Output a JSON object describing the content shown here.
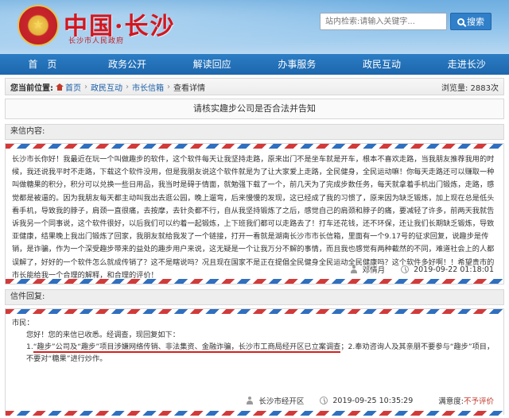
{
  "header": {
    "site_title": "中国·长沙",
    "site_subtitle": "长沙市人民政府",
    "emblem_star": "★",
    "search_placeholder": "站内检索:请输入关键字...",
    "search_button": "搜索"
  },
  "nav": [
    "首　页",
    "政务公开",
    "解读回应",
    "办事服务",
    "政民互动",
    "走进长沙"
  ],
  "breadcrumb": {
    "lead": "您当前位置:",
    "items": [
      "首页",
      "政民互动",
      "市长信箱",
      "查看详情"
    ],
    "views_label": "浏览量:",
    "views_value": "2883次"
  },
  "doc_title": "请核实趣步公司是否合法并告知",
  "letter": {
    "section_label": "来信内容:",
    "body": "长沙市长你好！我最近在玩一个叫做趣步的软件，这个软件每天让我坚持走路，原来出门不是坐车就是开车，根本不喜欢走路，当我朋友推荐我用的时候，我还说我平时不走路，下载这个软件没用，但是我朋友说这个软件就是为了让大家爱上走路，全民健身，全民运动嘛！你每天走路还可以赚取一种叫做糖果的积分，积分可以兑换一些日用品，我当时是碍于情面，就勉强下载了一个，前几天为了完成步数任务，每天就拿着手机出门锻炼，走路，感觉都是被逼的。因为我朋友每天都主动叫我出去逛公园，晚上遛弯，后来慢慢的发现，这已经成了我的习惯了，原来因为缺乏锻炼，加上现在总是低头看手机，导致我的脖子，肩颈一直很痛，去按摩，去针灸都不行，自从我坚持锻炼了之后，感觉自己的肩颈和脖子的痛，要减轻了许多，前两天我就告诉我另一个同事说，这个软件很好，以后我们可以约着一起锻炼，上下班我们都可以走路去了！打车还花钱，还不环保，还让我们长期缺乏锻炼，导致亚健康，结果晚上我出门锻炼了回家，我朋友就给我发了一个链接，打开一看就是湖南长沙市市长信箱，里面有一个9.17号的征求回复，说趣步是传销，是诈骗，作为一个深受趣步带来的益处的趣步用户来说，这无疑是一个让我万分不解的事情，而且我也感觉有两种截然的不同，难道社会上的人都误解了，好好的一个软件怎么就成传销了？这不是瞎说吗？况且现在国家不是正在提倡全民健身全民运动全民健康吗？这个软件多好啊！！希望贵市的市长能给我一个合理的解释，和合理的评价！",
    "author": "邓情月",
    "time": "2019-09-22  01:18:01"
  },
  "reply": {
    "section_label": "信件回复:",
    "greeting": "市民：",
    "intro": "您好！您的来信已收悉。经调查，现回复如下：",
    "item1_prefix": "1.",
    "item1_highlight": "“趣步”公司及“趣步”项目涉嫌网络传销、非法集资、金融诈骗，长沙市工商局经开区已立案调查",
    "item1_suffix": "；2.奉劝咨询人及其亲朋不要参与“趣步”项目，不要对“糖果”进行炒作。",
    "author": "长沙市经开区",
    "time": "2019-09-25  10:35:29",
    "rating_label": "满意度:",
    "rating_value": "不予评价"
  }
}
